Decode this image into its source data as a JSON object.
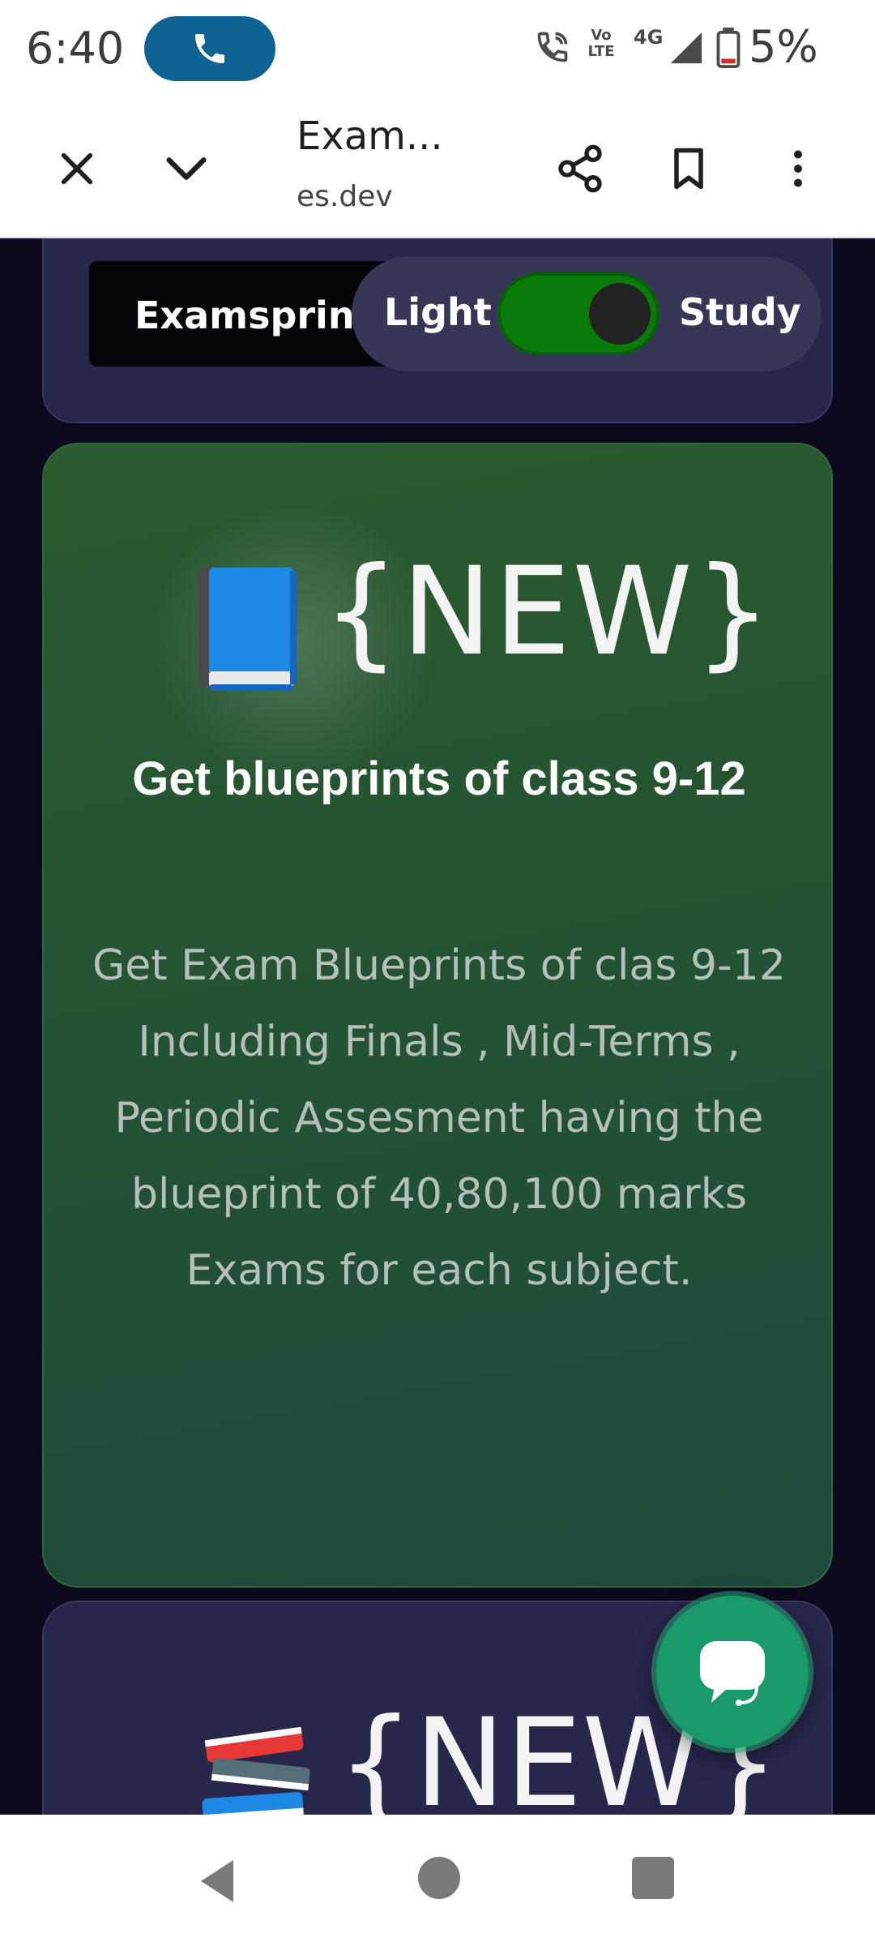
{
  "status_bar": {
    "time": "6:40",
    "network": "4G",
    "volte": "Vo LTE",
    "battery": "5%"
  },
  "browser": {
    "title": "Exam...",
    "url": "es.dev"
  },
  "header": {
    "brand": "Examsprint AI",
    "theme_left": "Light",
    "theme_right": "Study",
    "toggle_on": true
  },
  "feature_card": {
    "badge": "{NEW}",
    "icon": "blue-book-icon",
    "title": "Get blueprints of class 9-12",
    "description": "Get Exam Blueprints of clas 9-12 Including Finals , Mid-Terms , Periodic Assesment having the blueprint of 40,80,100 marks Exams for each subject."
  },
  "next_card": {
    "badge": "{NEW}",
    "icon": "books-stack-icon"
  },
  "colors": {
    "accent_green": "#0a7a0a",
    "card_green": "#245235",
    "page_bg": "#0d0a1f",
    "fab": "#1a9a6a"
  }
}
